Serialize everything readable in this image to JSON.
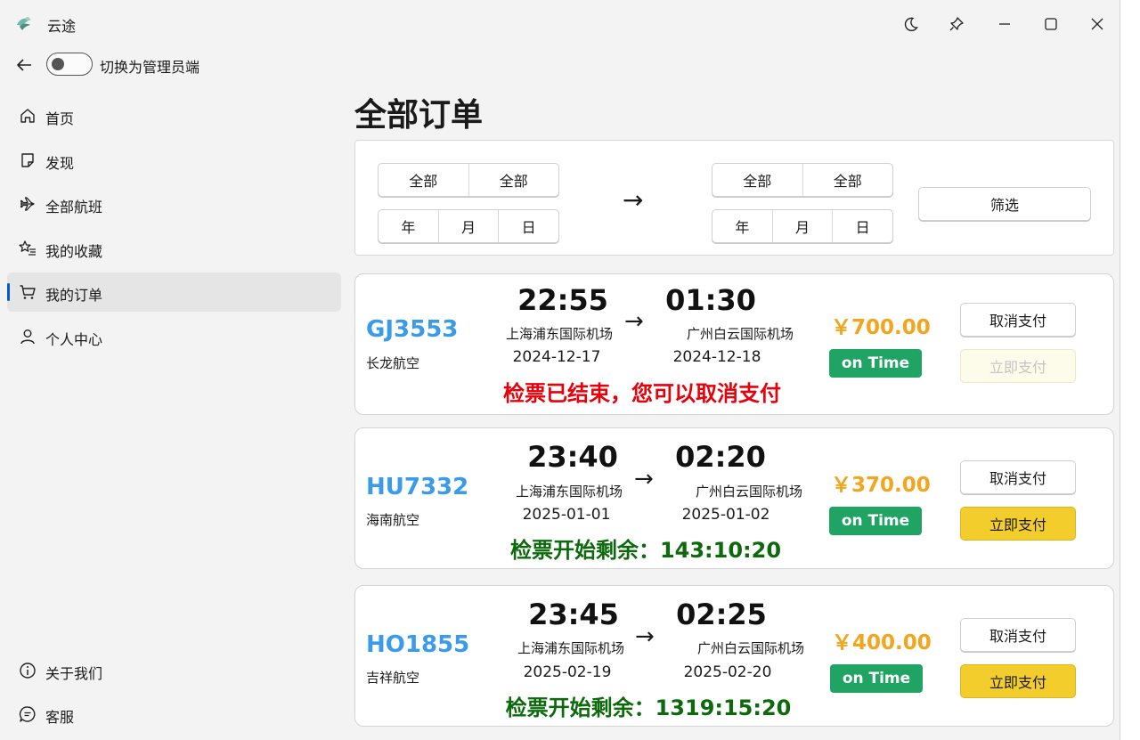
{
  "app": {
    "title": "云途"
  },
  "header": {
    "toggle_label": "切换为管理员端"
  },
  "sidebar": {
    "items": [
      {
        "label": "首页",
        "icon": "home-icon"
      },
      {
        "label": "发现",
        "icon": "sticky-note-icon"
      },
      {
        "label": "全部航班",
        "icon": "airplane-icon"
      },
      {
        "label": "我的收藏",
        "icon": "star-list-icon"
      },
      {
        "label": "我的订单",
        "icon": "cart-icon",
        "active": true
      },
      {
        "label": "个人中心",
        "icon": "person-icon"
      }
    ],
    "footer": [
      {
        "label": "关于我们",
        "icon": "info-icon"
      },
      {
        "label": "客服",
        "icon": "chat-icon"
      }
    ]
  },
  "main": {
    "title": "全部订单",
    "filter": {
      "from": {
        "place_a": "全部",
        "place_b": "全部",
        "year": "年",
        "month": "月",
        "day": "日"
      },
      "arrow": "→",
      "to": {
        "place_a": "全部",
        "place_b": "全部",
        "year": "年",
        "month": "月",
        "day": "日"
      },
      "button": "筛选"
    },
    "orders": [
      {
        "flight_no": "GJ3553",
        "airline": "长龙航空",
        "dep_time": "22:55",
        "dep_airport": "上海浦东国际机场",
        "dep_date": "2024-12-17",
        "arrow": "→",
        "arr_time": "01:30",
        "arr_airport": "广州白云国际机场",
        "arr_date": "2024-12-18",
        "message": "检票已结束，您可以取消支付",
        "price": "￥700.00",
        "status": "on Time",
        "cancel_label": "取消支付",
        "pay_label": "立即支付",
        "pay_enabled": false
      },
      {
        "flight_no": "HU7332",
        "airline": "海南航空",
        "dep_time": "23:40",
        "dep_airport": "上海浦东国际机场",
        "dep_date": "2025-01-01",
        "arrow": "→",
        "arr_time": "02:20",
        "arr_airport": "广州白云国际机场",
        "arr_date": "2025-01-02",
        "message": "检票开始剩余：143:10:20",
        "price": "￥370.00",
        "status": "on Time",
        "cancel_label": "取消支付",
        "pay_label": "立即支付",
        "pay_enabled": true
      },
      {
        "flight_no": "HO1855",
        "airline": "吉祥航空",
        "dep_time": "23:45",
        "dep_airport": "上海浦东国际机场",
        "dep_date": "2025-02-19",
        "arrow": "→",
        "arr_time": "02:25",
        "arr_airport": "广州白云国际机场",
        "arr_date": "2025-02-20",
        "message": "检票开始剩余：1319:15:20",
        "price": "￥400.00",
        "status": "on Time",
        "cancel_label": "取消支付",
        "pay_label": "立即支付",
        "pay_enabled": true
      }
    ]
  },
  "colors": {
    "accent": "#0a5bc4",
    "flight_no": "#3a9bea",
    "price": "#f2a51d",
    "status_bg": "#1fa463",
    "pay_button": "#f2cd2c",
    "message_red": "#e8000b",
    "message_green": "#0c6a0c"
  }
}
